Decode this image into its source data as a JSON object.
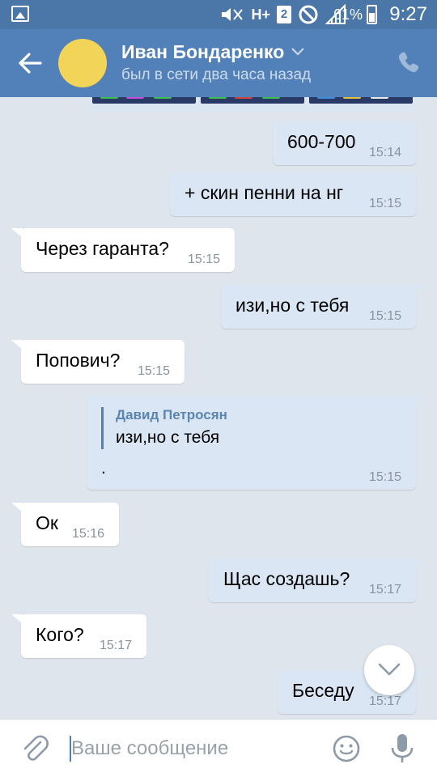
{
  "statusbar": {
    "network": "H+",
    "sim": "2",
    "battery_pct": "61%",
    "time": "9:27"
  },
  "header": {
    "name": "Иван Бондаренко",
    "status": "был в сети два часа назад"
  },
  "messages": [
    {
      "dir": "out",
      "text": "600-700",
      "time": "15:14"
    },
    {
      "dir": "out",
      "text": "+ скин пенни на нг",
      "time": "15:15"
    },
    {
      "dir": "in",
      "text": "Через гаранта?",
      "time": "15:15"
    },
    {
      "dir": "out",
      "text": "изи,но с тебя",
      "time": "15:15"
    },
    {
      "dir": "in",
      "text": "Попович?",
      "time": "15:15"
    },
    {
      "dir": "out",
      "reply_author": "Давид Петросян",
      "reply_text": "изи,но с тебя",
      "text": ".",
      "time": "15:15"
    },
    {
      "dir": "in",
      "text": "Ок",
      "time": "15:16"
    },
    {
      "dir": "out",
      "text": "Щас создашь?",
      "time": "15:17"
    },
    {
      "dir": "in",
      "text": "Кого?",
      "time": "15:17"
    },
    {
      "dir": "out",
      "text": "Беседу",
      "time": "15:17"
    }
  ],
  "composer": {
    "placeholder": "Ваше сообщение"
  },
  "colors": {
    "header": "#5181b8",
    "statusbar": "#4a76a8",
    "background": "#dfe5ec",
    "incoming_bubble": "#ffffff",
    "outgoing_bubble": "#dae6f4",
    "avatar": "#f2d458"
  },
  "icons": {
    "back": "arrow-left-icon",
    "dropdown": "chevron-down-icon",
    "call": "phone-icon",
    "attach": "paperclip-icon",
    "emoji": "smile-icon",
    "voice": "microphone-icon",
    "scroll": "chevron-down-icon"
  }
}
